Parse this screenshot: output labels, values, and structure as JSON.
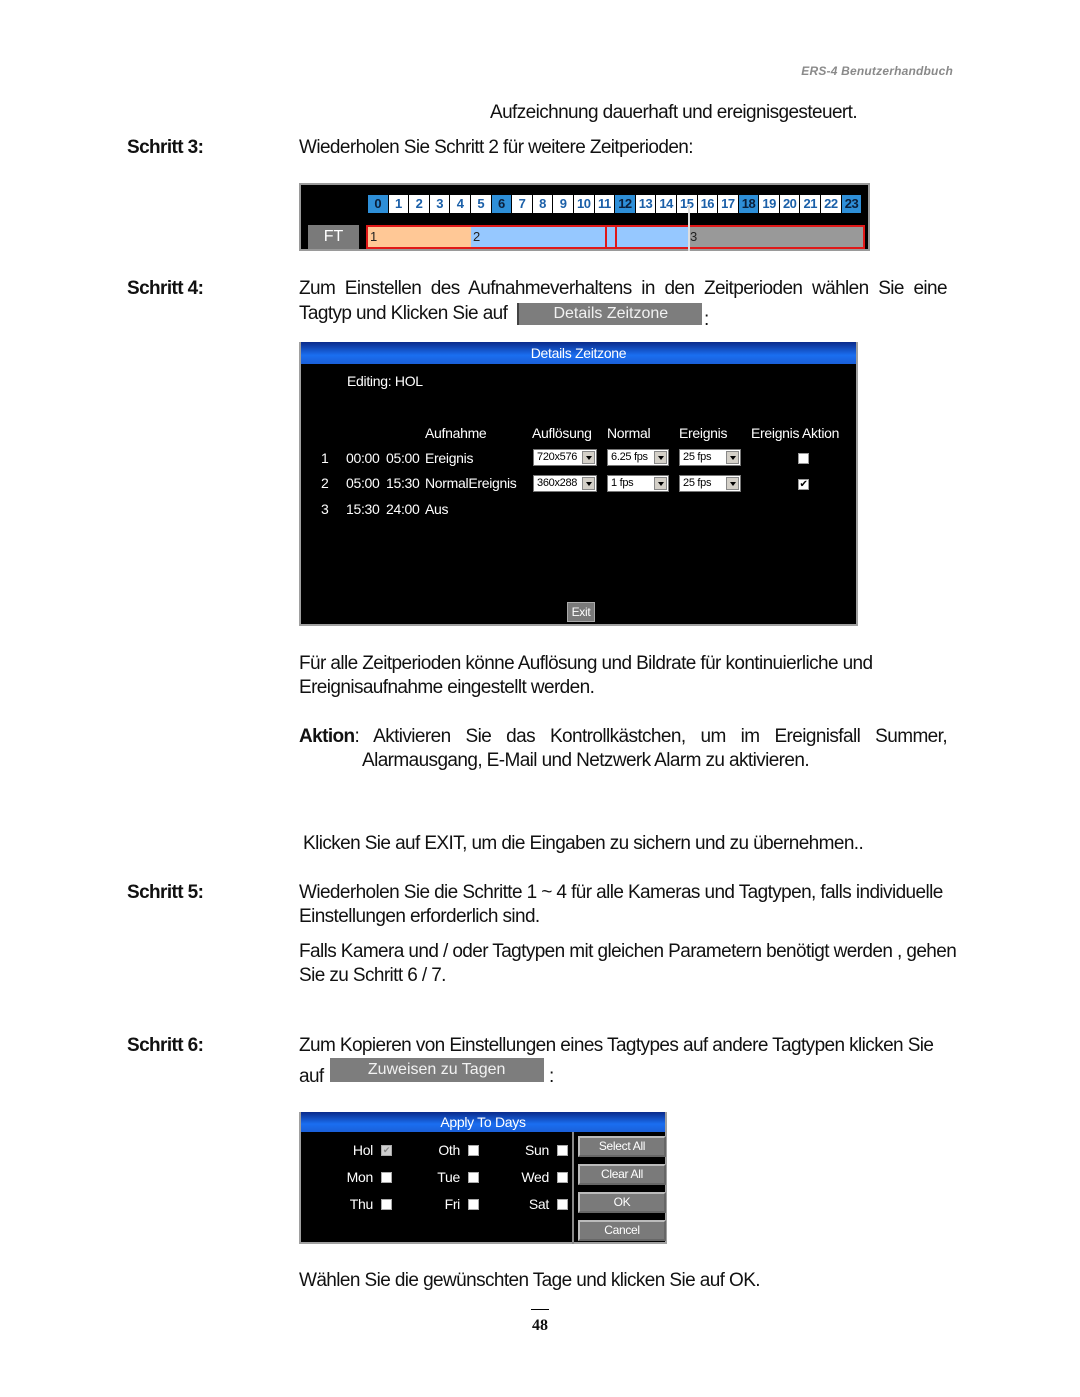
{
  "header": {
    "title": "ERS-4  Benutzerhandbuch"
  },
  "intro_line": "Aufzeichnung dauerhaft und ereignisgesteuert.",
  "step3": {
    "label": "Schritt 3:",
    "text": "Wiederholen Sie Schritt 2 für weitere Zeitperioden:"
  },
  "timeline": {
    "hours": [
      "0",
      "1",
      "2",
      "3",
      "4",
      "5",
      "6",
      "7",
      "8",
      "9",
      "10",
      "11",
      "12",
      "13",
      "14",
      "15",
      "16",
      "17",
      "18",
      "19",
      "20",
      "21",
      "22",
      "23"
    ],
    "highlighted_hours": [
      0,
      6,
      12,
      18,
      23
    ],
    "day_type_button": "FT",
    "segments": [
      {
        "label": "1",
        "color": "#ffc896"
      },
      {
        "label": "2",
        "color": "#96c8ff"
      },
      {
        "label": "3",
        "color": "#999999"
      }
    ]
  },
  "step4": {
    "label": "Schritt 4:",
    "text_line1": "Zum Einstellen des Aufnahmeverhaltens in den Zeitperioden wählen Sie eine",
    "text_line2": "Tagtyp und Klicken Sie auf",
    "button": "Details Zeitzone",
    "suffix": ":"
  },
  "details_dialog": {
    "title": "Details Zeitzone",
    "editing": "Editing: HOL",
    "columns": [
      "Aufnahme",
      "Auflösung",
      "Normal",
      "Ereignis",
      "Ereignis Aktion"
    ],
    "rows": [
      {
        "num": "1",
        "start": "00:00",
        "end": "05:00",
        "mode": "Ereignis",
        "resolution": "720x576",
        "normal": "6.25 fps",
        "event": "25 fps",
        "action_checked": false
      },
      {
        "num": "2",
        "start": "05:00",
        "end": "15:30",
        "mode": "NormalEreignis",
        "resolution": "360x288",
        "normal": "1 fps",
        "event": "25 fps",
        "action_checked": true
      },
      {
        "num": "3",
        "start": "15:30",
        "end": "24:00",
        "mode": "Aus"
      }
    ],
    "exit_button": "Exit"
  },
  "para_resolution": {
    "line1": "Für alle Zeitperioden könne Auflösung und Bildrate für kontinuierliche und",
    "line2": "Ereignisaufnahme eingestellt werden."
  },
  "aktion": {
    "label": "Aktion",
    "line1": ": Aktivieren Sie das Kontrollkästchen, um im Ereignisfall Summer,",
    "line2": "Alarmausgang, E-Mail und Netzwerk Alarm zu aktivieren."
  },
  "exit_note": "Klicken Sie auf EXIT, um die Eingaben zu sichern und zu übernehmen..",
  "step5": {
    "label": "Schritt 5:",
    "line1": "Wiederholen Sie die Schritte 1 ~ 4 für alle Kameras und Tagtypen, falls individuelle",
    "line2": "Einstellungen erforderlich sind.",
    "line3": "Falls Kamera und / oder Tagtypen mit gleichen Parametern benötigt werden , gehen",
    "line4": "Sie zu Schritt 6 / 7."
  },
  "step6": {
    "label": "Schritt 6:",
    "line1": "Zum Kopieren von Einstellungen eines Tagtypes auf andere Tagtypen klicken Sie",
    "line2_prefix": "auf",
    "button": "Zuweisen zu Tagen",
    "suffix": ":"
  },
  "apply_dialog": {
    "title": "Apply To Days",
    "days": [
      {
        "label": "Hol",
        "checked": true,
        "disabled": true
      },
      {
        "label": "Oth",
        "checked": false
      },
      {
        "label": "Sun",
        "checked": false
      },
      {
        "label": "Mon",
        "checked": false
      },
      {
        "label": "Tue",
        "checked": false
      },
      {
        "label": "Wed",
        "checked": false
      },
      {
        "label": "Thu",
        "checked": false
      },
      {
        "label": "Fri",
        "checked": false
      },
      {
        "label": "Sat",
        "checked": false
      }
    ],
    "buttons": [
      "Select All",
      "Clear All",
      "OK",
      "Cancel"
    ]
  },
  "final_note": "Wählen Sie die gewünschten Tage und klicken Sie auf  OK.",
  "page_number": "48"
}
